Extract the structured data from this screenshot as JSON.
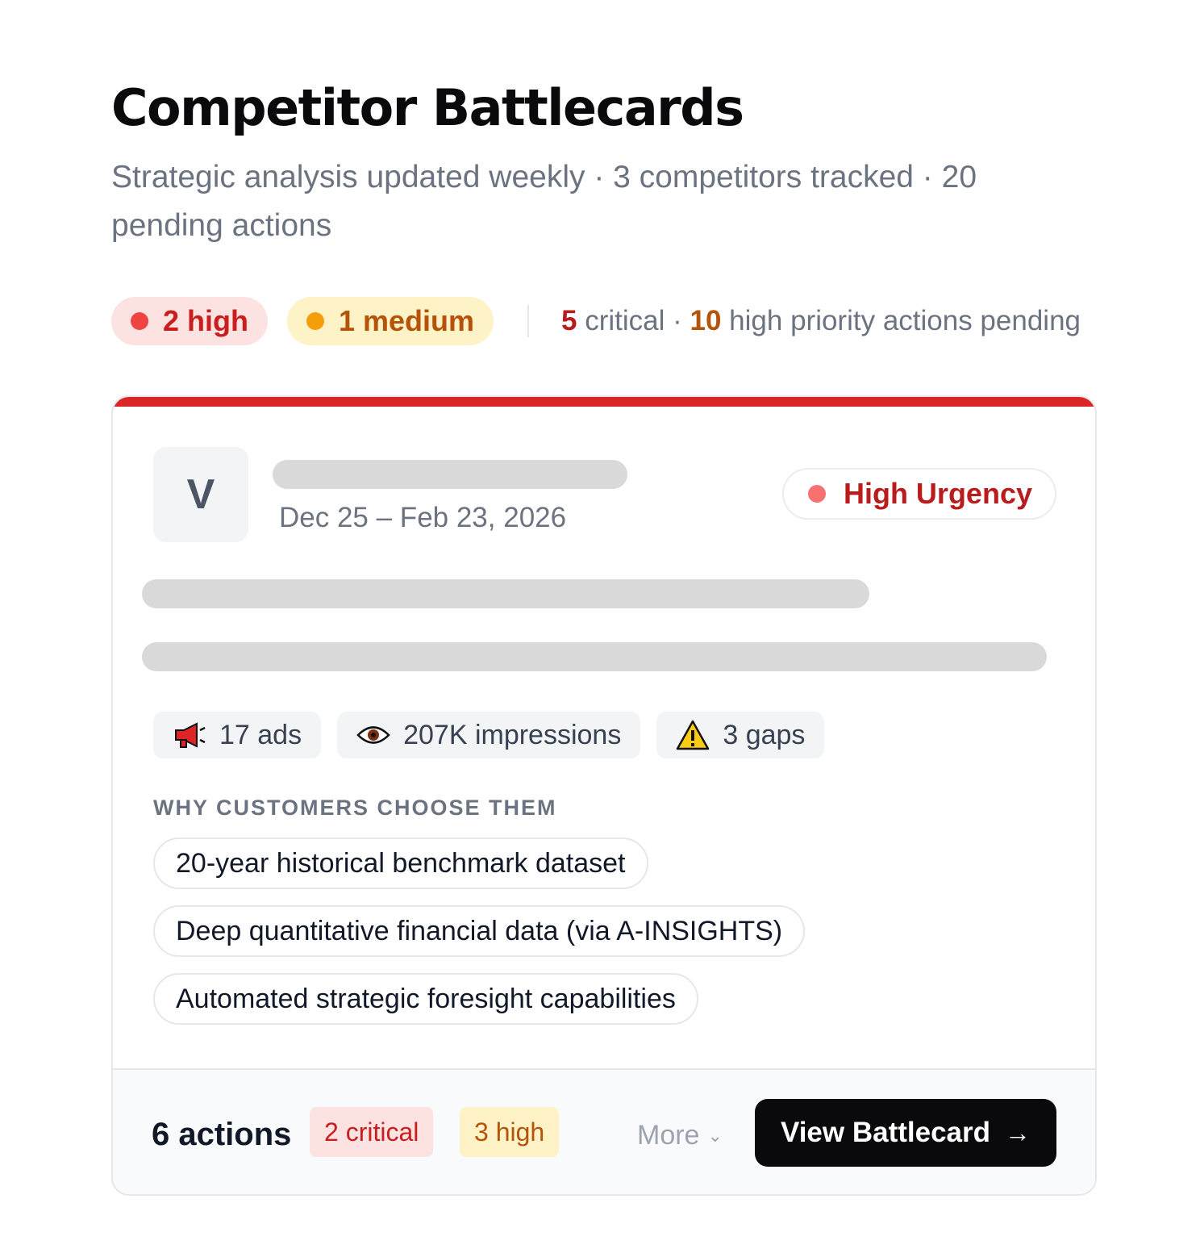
{
  "header": {
    "title": "Competitor Battlecards",
    "subtitle": "Strategic analysis updated weekly · 3 competitors tracked · 20 pending actions"
  },
  "summary": {
    "high_pill": "2 high",
    "medium_pill": "1 medium",
    "critical_count": "5",
    "critical_label": " critical · ",
    "high_count": "10",
    "high_label": " high priority actions pending",
    "colors": {
      "high": "#ef4444",
      "medium": "#f59e0b",
      "critical_text": "#b91c1c"
    }
  },
  "card": {
    "accent_color": "#dc2626",
    "avatar_letter": "V",
    "date_range": "Dec 25 – Feb 23, 2026",
    "urgency": "High Urgency",
    "stats": [
      {
        "icon": "megaphone-icon",
        "label": "17 ads"
      },
      {
        "icon": "eye-icon",
        "label": "207K impressions"
      },
      {
        "icon": "warning-icon",
        "label": "3 gaps"
      }
    ],
    "section_label": "WHY CUSTOMERS CHOOSE THEM",
    "reasons": [
      "20-year historical benchmark dataset",
      "Deep quantitative financial data (via A-INSIGHTS)",
      "Automated strategic foresight capabilities"
    ],
    "footer": {
      "actions": "6 actions",
      "critical_badge": "2 critical",
      "high_badge": "3 high",
      "more_label": "More",
      "view_button": "View Battlecard"
    }
  }
}
